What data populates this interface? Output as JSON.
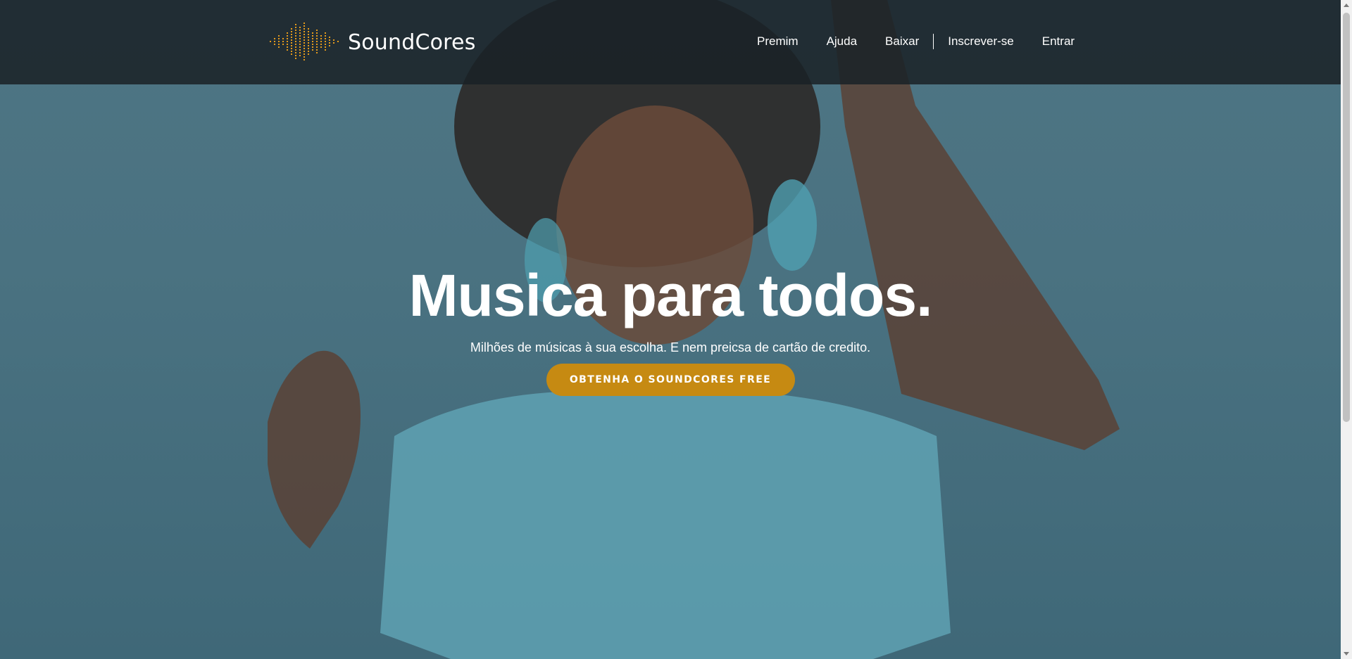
{
  "brand": {
    "name": "SoundCores",
    "logo_icon": "sound-wave-icon",
    "accent": "#e39a1c"
  },
  "nav": {
    "premium": "Premim",
    "help": "Ajuda",
    "download": "Baixar",
    "signup": "Inscrever-se",
    "login": "Entrar"
  },
  "hero": {
    "title": "Musica para todos.",
    "subtitle": "Milhões de músicas à sua escolha. E nem preicsa de cartão de credito.",
    "cta_label": "OBTENHA O SOUNDCORES FREE",
    "cta_color": "#c68a12",
    "overlay_color": "#4a7281"
  }
}
